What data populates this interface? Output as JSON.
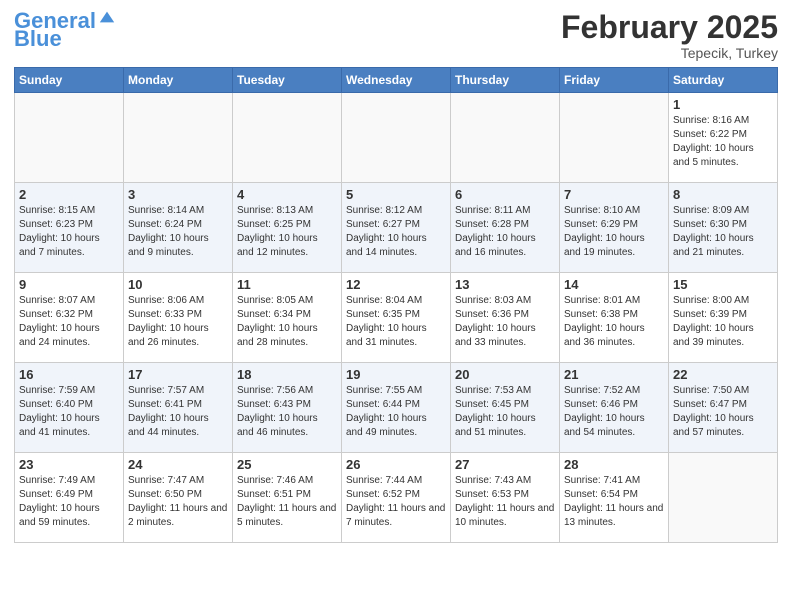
{
  "header": {
    "logo_general": "General",
    "logo_blue": "Blue",
    "month": "February 2025",
    "location": "Tepecik, Turkey"
  },
  "days_of_week": [
    "Sunday",
    "Monday",
    "Tuesday",
    "Wednesday",
    "Thursday",
    "Friday",
    "Saturday"
  ],
  "weeks": [
    {
      "days": [
        {
          "num": "",
          "info": ""
        },
        {
          "num": "",
          "info": ""
        },
        {
          "num": "",
          "info": ""
        },
        {
          "num": "",
          "info": ""
        },
        {
          "num": "",
          "info": ""
        },
        {
          "num": "",
          "info": ""
        },
        {
          "num": "1",
          "info": "Sunrise: 8:16 AM\nSunset: 6:22 PM\nDaylight: 10 hours and 5 minutes."
        }
      ]
    },
    {
      "days": [
        {
          "num": "2",
          "info": "Sunrise: 8:15 AM\nSunset: 6:23 PM\nDaylight: 10 hours and 7 minutes."
        },
        {
          "num": "3",
          "info": "Sunrise: 8:14 AM\nSunset: 6:24 PM\nDaylight: 10 hours and 9 minutes."
        },
        {
          "num": "4",
          "info": "Sunrise: 8:13 AM\nSunset: 6:25 PM\nDaylight: 10 hours and 12 minutes."
        },
        {
          "num": "5",
          "info": "Sunrise: 8:12 AM\nSunset: 6:27 PM\nDaylight: 10 hours and 14 minutes."
        },
        {
          "num": "6",
          "info": "Sunrise: 8:11 AM\nSunset: 6:28 PM\nDaylight: 10 hours and 16 minutes."
        },
        {
          "num": "7",
          "info": "Sunrise: 8:10 AM\nSunset: 6:29 PM\nDaylight: 10 hours and 19 minutes."
        },
        {
          "num": "8",
          "info": "Sunrise: 8:09 AM\nSunset: 6:30 PM\nDaylight: 10 hours and 21 minutes."
        }
      ]
    },
    {
      "days": [
        {
          "num": "9",
          "info": "Sunrise: 8:07 AM\nSunset: 6:32 PM\nDaylight: 10 hours and 24 minutes."
        },
        {
          "num": "10",
          "info": "Sunrise: 8:06 AM\nSunset: 6:33 PM\nDaylight: 10 hours and 26 minutes."
        },
        {
          "num": "11",
          "info": "Sunrise: 8:05 AM\nSunset: 6:34 PM\nDaylight: 10 hours and 28 minutes."
        },
        {
          "num": "12",
          "info": "Sunrise: 8:04 AM\nSunset: 6:35 PM\nDaylight: 10 hours and 31 minutes."
        },
        {
          "num": "13",
          "info": "Sunrise: 8:03 AM\nSunset: 6:36 PM\nDaylight: 10 hours and 33 minutes."
        },
        {
          "num": "14",
          "info": "Sunrise: 8:01 AM\nSunset: 6:38 PM\nDaylight: 10 hours and 36 minutes."
        },
        {
          "num": "15",
          "info": "Sunrise: 8:00 AM\nSunset: 6:39 PM\nDaylight: 10 hours and 39 minutes."
        }
      ]
    },
    {
      "days": [
        {
          "num": "16",
          "info": "Sunrise: 7:59 AM\nSunset: 6:40 PM\nDaylight: 10 hours and 41 minutes."
        },
        {
          "num": "17",
          "info": "Sunrise: 7:57 AM\nSunset: 6:41 PM\nDaylight: 10 hours and 44 minutes."
        },
        {
          "num": "18",
          "info": "Sunrise: 7:56 AM\nSunset: 6:43 PM\nDaylight: 10 hours and 46 minutes."
        },
        {
          "num": "19",
          "info": "Sunrise: 7:55 AM\nSunset: 6:44 PM\nDaylight: 10 hours and 49 minutes."
        },
        {
          "num": "20",
          "info": "Sunrise: 7:53 AM\nSunset: 6:45 PM\nDaylight: 10 hours and 51 minutes."
        },
        {
          "num": "21",
          "info": "Sunrise: 7:52 AM\nSunset: 6:46 PM\nDaylight: 10 hours and 54 minutes."
        },
        {
          "num": "22",
          "info": "Sunrise: 7:50 AM\nSunset: 6:47 PM\nDaylight: 10 hours and 57 minutes."
        }
      ]
    },
    {
      "days": [
        {
          "num": "23",
          "info": "Sunrise: 7:49 AM\nSunset: 6:49 PM\nDaylight: 10 hours and 59 minutes."
        },
        {
          "num": "24",
          "info": "Sunrise: 7:47 AM\nSunset: 6:50 PM\nDaylight: 11 hours and 2 minutes."
        },
        {
          "num": "25",
          "info": "Sunrise: 7:46 AM\nSunset: 6:51 PM\nDaylight: 11 hours and 5 minutes."
        },
        {
          "num": "26",
          "info": "Sunrise: 7:44 AM\nSunset: 6:52 PM\nDaylight: 11 hours and 7 minutes."
        },
        {
          "num": "27",
          "info": "Sunrise: 7:43 AM\nSunset: 6:53 PM\nDaylight: 11 hours and 10 minutes."
        },
        {
          "num": "28",
          "info": "Sunrise: 7:41 AM\nSunset: 6:54 PM\nDaylight: 11 hours and 13 minutes."
        },
        {
          "num": "",
          "info": ""
        }
      ]
    }
  ]
}
